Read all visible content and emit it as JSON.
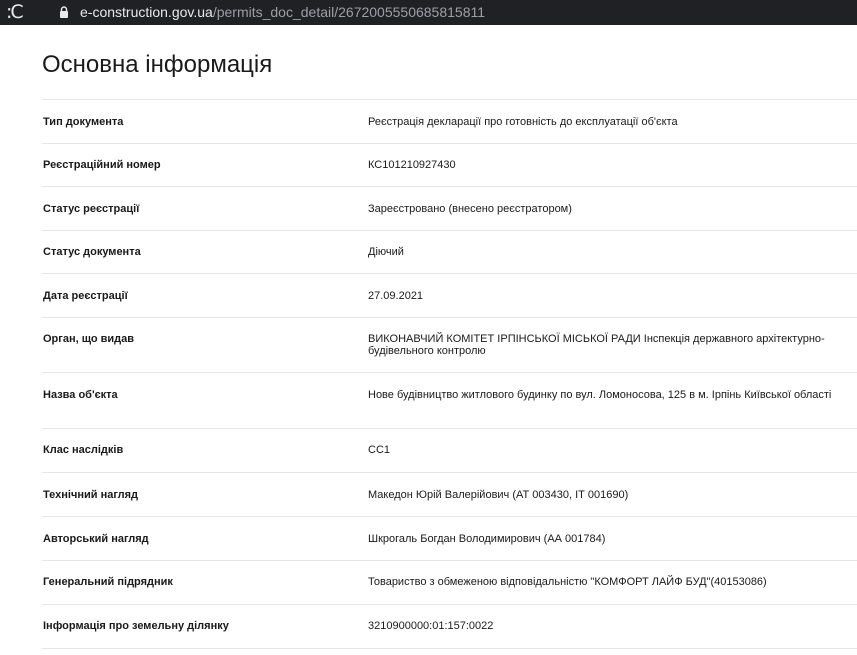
{
  "browser": {
    "url_host": "e-construction.gov.ua",
    "url_path": "/permits_doc_detail/2672005550685815811",
    "reload_icon": "reload-icon",
    "lock_icon": "lock-icon"
  },
  "page": {
    "title": "Основна інформація"
  },
  "rows": [
    {
      "label": "Тип документа",
      "value": "Реєстрація декларації про готовність до експлуатації об'єкта"
    },
    {
      "label": "Реєстраційний номер",
      "value": "КС101210927430"
    },
    {
      "label": "Статус реєстрації",
      "value": "Зареєстровано (внесено реєстратором)"
    },
    {
      "label": "Статус документа",
      "value": "Діючий"
    },
    {
      "label": "Дата реєстрації",
      "value": "27.09.2021"
    },
    {
      "label": "Орган, що видав",
      "value": "ВИКОНАВЧИЙ КОМІТЕТ ІРПІНСЬКОЇ МІСЬКОЇ РАДИ Інспекція державного архітектурно-будівельного контролю"
    },
    {
      "label": "Назва об'єкта",
      "value": "Нове будівництво житлового будинку по вул. Ломоносова, 125 в м. Ірпінь Київської області"
    },
    {
      "label": "Клас наслідків",
      "value": "СС1"
    },
    {
      "label": "Технічний нагляд",
      "value": "Македон Юрій Валерійович (АТ 003430, ІТ 001690)"
    },
    {
      "label": "Авторський нагляд",
      "value": "Шкрогаль Богдан Володимирович (АА 001784)"
    },
    {
      "label": "Генеральний підрядник",
      "value": "Товариство з обмеженою відповідальністю \"КОМФОРТ ЛАЙФ БУД\"(40153086)"
    },
    {
      "label": "Інформація про земельну ділянку",
      "value": "3210900000:01:157:0022"
    }
  ]
}
